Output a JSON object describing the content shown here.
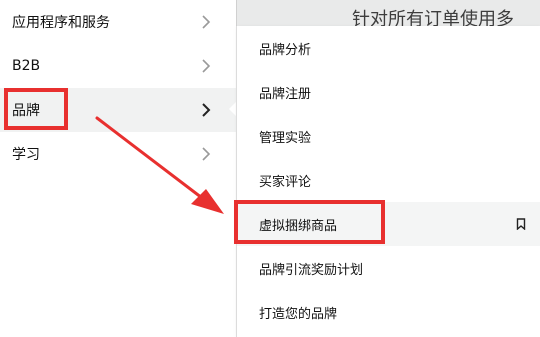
{
  "background": {
    "title": "针对所有订单使用多",
    "bg_color": "#e9eaea"
  },
  "left_menu": {
    "items": [
      {
        "label": "应用程序和服务",
        "active": false
      },
      {
        "label": "B2B",
        "active": false
      },
      {
        "label": "品牌",
        "active": true
      },
      {
        "label": "学习",
        "active": false
      }
    ]
  },
  "submenu": {
    "items": [
      {
        "label": "品牌分析"
      },
      {
        "label": "品牌注册"
      },
      {
        "label": "管理实验"
      },
      {
        "label": "买家评论"
      },
      {
        "label": "虚拟捆绑商品",
        "active": true,
        "bookmark_icon": "bookmark-icon"
      },
      {
        "label": "品牌引流奖励计划"
      },
      {
        "label": "打造您的品牌"
      }
    ]
  },
  "annotation": {
    "color": "#e8302f"
  }
}
